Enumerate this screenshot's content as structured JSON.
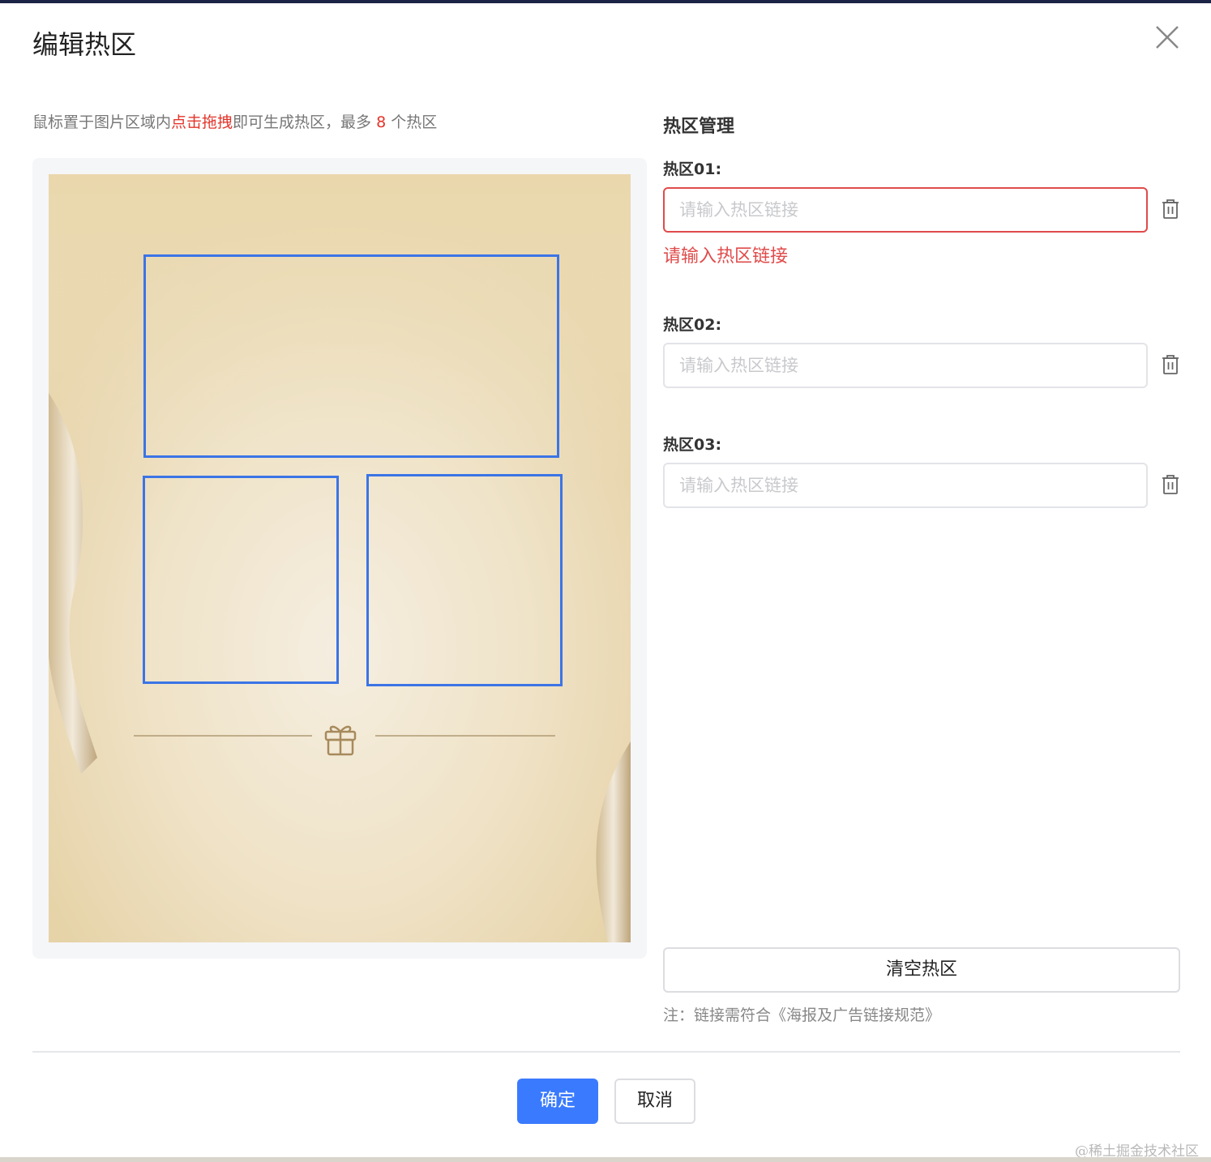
{
  "dialog": {
    "title": "编辑热区"
  },
  "hint": {
    "prefix": "鼠标置于图片区域内",
    "highlight": "点击拖拽",
    "middle": "即可生成热区，最多 ",
    "max_count": "8",
    "suffix": " 个热区"
  },
  "management": {
    "title": "热区管理",
    "zones": [
      {
        "label": "热区01:",
        "placeholder": "请输入热区链接",
        "value": "",
        "error": "请输入热区链接"
      },
      {
        "label": "热区02:",
        "placeholder": "请输入热区链接",
        "value": ""
      },
      {
        "label": "热区03:",
        "placeholder": "请输入热区链接",
        "value": ""
      }
    ],
    "clear_label": "清空热区",
    "note": "注：链接需符合《海报及广告链接规范》"
  },
  "footer": {
    "ok_label": "确定",
    "cancel_label": "取消"
  },
  "watermark": "@稀土掘金技术社区",
  "colors": {
    "primary": "#3a7afe",
    "hotzone_border": "#3b74e6",
    "error": "#e04b4b",
    "highlight": "#e3352b"
  },
  "icons": {
    "close": "close-icon",
    "delete": "trash-icon",
    "gift": "gift-icon"
  }
}
